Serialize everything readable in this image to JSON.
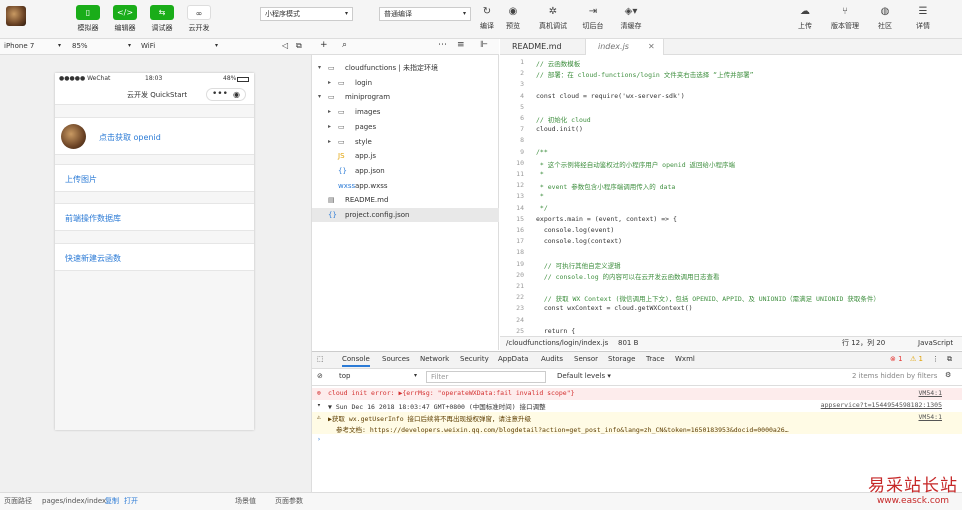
{
  "toolbar": {
    "buttons": [
      {
        "label": "模拟器",
        "icon": "phone-icon"
      },
      {
        "label": "编辑器",
        "icon": "code-icon"
      },
      {
        "label": "调试器",
        "icon": "debug-icon"
      },
      {
        "label": "云开发",
        "icon": "cloud-icon"
      }
    ],
    "mode_select": "小程序模式",
    "compile_select": "普通编译",
    "actions": [
      {
        "label": "编译",
        "icon": "refresh-icon"
      },
      {
        "label": "预览",
        "icon": "eye-icon"
      },
      {
        "label": "真机调试",
        "icon": "bug-icon"
      },
      {
        "label": "切后台",
        "icon": "background-icon"
      },
      {
        "label": "清缓存",
        "icon": "layers-icon"
      }
    ],
    "right": [
      {
        "label": "上传",
        "icon": "upload-icon"
      },
      {
        "label": "版本管理",
        "icon": "version-icon"
      },
      {
        "label": "社区",
        "icon": "community-icon"
      },
      {
        "label": "详情",
        "icon": "menu-icon"
      }
    ]
  },
  "simulator": {
    "device": "iPhone 7",
    "zoom": "85%",
    "network": "WiFi",
    "status_carrier": "●●●●● WeChat",
    "status_time": "18:03",
    "status_battery": "48%",
    "nav_title": "云开发 QuickStart",
    "capsule_dots": "•••",
    "capsule_close": "◉",
    "items": [
      "点击获取 openid",
      "上传图片",
      "前端操作数据库",
      "快速新建云函数"
    ]
  },
  "sim_footer": {
    "path_label": "页面路径",
    "path": "pages/index/index",
    "copy": "复制",
    "open": "打开",
    "scene": "场景值",
    "params": "页面参数"
  },
  "tree": {
    "items": [
      {
        "name": "cloudfunctions | 未指定环境",
        "type": "folder",
        "open": true,
        "depth": 0
      },
      {
        "name": "login",
        "type": "folder",
        "open": false,
        "depth": 1
      },
      {
        "name": "miniprogram",
        "type": "folder",
        "open": true,
        "depth": 0
      },
      {
        "name": "images",
        "type": "folder",
        "open": false,
        "depth": 1
      },
      {
        "name": "pages",
        "type": "folder",
        "open": false,
        "depth": 1
      },
      {
        "name": "style",
        "type": "folder",
        "open": false,
        "depth": 1
      },
      {
        "name": "app.js",
        "type": "js",
        "depth": 1
      },
      {
        "name": "app.json",
        "type": "json",
        "depth": 1
      },
      {
        "name": "app.wxss",
        "type": "wxss",
        "depth": 1
      },
      {
        "name": "README.md",
        "type": "md",
        "depth": 0
      },
      {
        "name": "project.config.json",
        "type": "json",
        "depth": 0
      }
    ]
  },
  "editor": {
    "tabs": [
      "README.md",
      "index.js"
    ],
    "lines": [
      {
        "n": "1",
        "t": "// 云函数模板",
        "c": "comment"
      },
      {
        "n": "2",
        "t": "// 部署：在 cloud-functions/login 文件夹右击选择 “上传并部署”",
        "c": "comment"
      },
      {
        "n": "3",
        "t": "",
        "c": "code"
      },
      {
        "n": "4",
        "t": "const cloud = require('wx-server-sdk')",
        "c": "code"
      },
      {
        "n": "5",
        "t": "",
        "c": "code"
      },
      {
        "n": "6",
        "t": "// 初始化 cloud",
        "c": "comment"
      },
      {
        "n": "7",
        "t": "cloud.init()",
        "c": "code"
      },
      {
        "n": "8",
        "t": "",
        "c": "code"
      },
      {
        "n": "9",
        "t": "/**",
        "c": "comment"
      },
      {
        "n": "10",
        "t": " * 这个示例将经自动鉴权过的小程序用户 openid 返回给小程序端",
        "c": "comment"
      },
      {
        "n": "11",
        "t": " *",
        "c": "comment"
      },
      {
        "n": "12",
        "t": " * event 参数包含小程序端调用传入的 data",
        "c": "comment"
      },
      {
        "n": "13",
        "t": " *",
        "c": "comment"
      },
      {
        "n": "14",
        "t": " */",
        "c": "comment"
      },
      {
        "n": "15",
        "t": "exports.main = (event, context) => {",
        "c": "code"
      },
      {
        "n": "16",
        "t": "  console.log(event)",
        "c": "code"
      },
      {
        "n": "17",
        "t": "  console.log(context)",
        "c": "code"
      },
      {
        "n": "18",
        "t": "",
        "c": "code"
      },
      {
        "n": "19",
        "t": "  // 可执行其他自定义逻辑",
        "c": "comment"
      },
      {
        "n": "20",
        "t": "  // console.log 的内容可以在云开发云函数调用日志查看",
        "c": "comment"
      },
      {
        "n": "21",
        "t": "",
        "c": "code"
      },
      {
        "n": "22",
        "t": "  // 获取 WX Context (微信调用上下文)，包括 OPENID、APPID、及 UNIONID（需满足 UNIONID 获取条件）",
        "c": "comment"
      },
      {
        "n": "23",
        "t": "  const wxContext = cloud.getWXContext()",
        "c": "code"
      },
      {
        "n": "24",
        "t": "",
        "c": "code"
      },
      {
        "n": "25",
        "t": "  return {",
        "c": "code"
      }
    ],
    "status_path": "/cloudfunctions/login/index.js",
    "status_size": "801 B",
    "status_pos": "行 12，列 20",
    "status_lang": "JavaScript"
  },
  "devtools": {
    "tabs": [
      "Console",
      "Sources",
      "Network",
      "Security",
      "AppData",
      "Audits",
      "Sensor",
      "Storage",
      "Trace",
      "Wxml"
    ],
    "error_count": "1",
    "warn_count": "1",
    "context": "top",
    "filter_placeholder": "Filter",
    "levels": "Default levels ▾",
    "hidden": "2 items hidden by filters",
    "logs": [
      {
        "level": "error",
        "text": "cloud init error:  ▶{errMsg: \"operateWXData:fail invalid scope\"}",
        "src": "VM54:1"
      },
      {
        "level": "info",
        "text": "▼ Sun Dec 16 2018 18:03:47 GMT+0800 (中国标准时间) 接口调整",
        "src": "appservice?t=1544954598182:1305"
      },
      {
        "level": "warn",
        "text": "▶获取 wx.getUserInfo 接口后续将不再出现授权弹窗，请注意升级",
        "src": "VM54:1"
      },
      {
        "level": "warn2",
        "text": "参考文档: https://developers.weixin.qq.com/blogdetail?action=get_post_info&lang=zh_CN&token=1650183953&docid=0000a26…",
        "src": ""
      }
    ],
    "prompt": "›"
  },
  "watermark": {
    "title": "易采站长站",
    "url": "www.easck.com"
  }
}
